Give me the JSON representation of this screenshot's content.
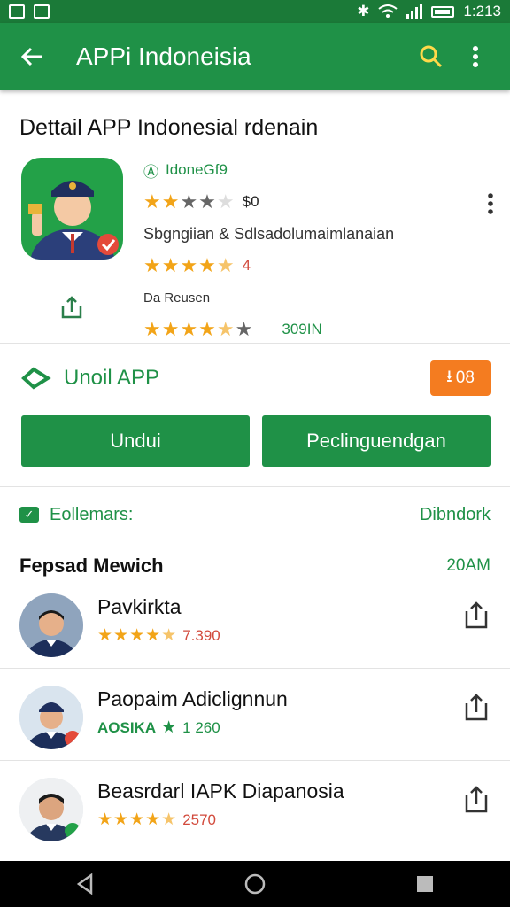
{
  "status_bar": {
    "time": "1:213",
    "icons": [
      "photo-icon",
      "image-icon",
      "bluetooth-icon",
      "wifi-icon",
      "signal-icon",
      "battery-icon"
    ]
  },
  "app_bar": {
    "title": "APPi Indoneisia",
    "icons": [
      "back-arrow-icon",
      "search-icon",
      "more-vert-icon"
    ]
  },
  "detail": {
    "title": "Dettail APP Indonesial rdenain",
    "developer": "IdoneGf9",
    "rating_score": "$0",
    "category": "Sbgngiian & Sdlsadolumaimlanaian",
    "rating_stars_2": "4",
    "reviews_label": "Da Reusen",
    "downloads": "309IN"
  },
  "install": {
    "label": "Unoil APP",
    "badge_value": "08",
    "primary_button": "Undui",
    "secondary_button": "Peclinguendgan"
  },
  "section": {
    "left": "Eollemars:",
    "right": "Dibndork"
  },
  "list": {
    "title": "Fepsad Mewich",
    "time": "20AM",
    "items": [
      {
        "name": "Pavkirkta",
        "stars": 4,
        "value": "7.390"
      },
      {
        "name": "Paopaim Adiclignnun",
        "badge": "AOSIKA",
        "value": "1 260"
      },
      {
        "name": "Beasrdarl IAPK Diapanosia",
        "stars": 4,
        "value": "2570"
      }
    ]
  },
  "colors": {
    "primary": "#1f9147",
    "status": "#1b7a38",
    "accent": "#f47c20",
    "star": "#f2a418"
  }
}
